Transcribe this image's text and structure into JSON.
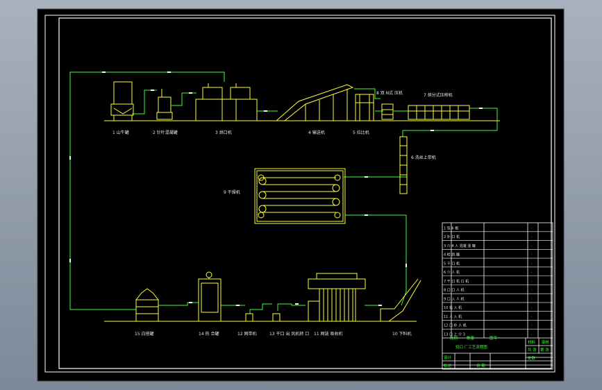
{
  "drawing": {
    "colors": {
      "frame": "#ffffff",
      "equipment": "#ffff33",
      "pipe": "#39ff39",
      "label": "#e8e8e8",
      "title": "#39ff39"
    },
    "labels": {
      "l1": "1 山牛罐",
      "l2": "2 针叶混凝罐",
      "l3": "3 烘口机",
      "l4": "4 输送机",
      "l5": "5 拉比机",
      "l6": "6 洗丝上带机",
      "l7": "7 烘分式压榨机",
      "l8": "8 双 N式 压机",
      "l9": "9 干燥机",
      "l10": "10 下料机",
      "l11": "11 网链 吸收机",
      "l12": "12 网带机",
      "l13": "13 干口 出 风机转 口",
      "l14": "14 热 合罐",
      "l15": "15 白搭罐"
    },
    "title_block": {
      "title": "饲口 厂工艺流程图",
      "rows": [
        "1 包 6 根",
        "2 扑 口 机",
        "3 介 4 人 混凝 混 罐",
        "4 检 具 器",
        "5 干 口 机",
        "6 介 人 机",
        "7 干 口 机 口 机",
        "8 口 口 人 机",
        "9 口 入 人 机",
        "10 机 入 机",
        "11 人 入 机",
        "12 口 扑 人 机",
        "13 口 上 介 3"
      ],
      "cells": {
        "c1": "比例",
        "c2": "数量",
        "c3": "共 张",
        "c4": "第 张",
        "c5": "材料",
        "c6": "图号",
        "c7": "设计",
        "c8": "审核",
        "c9": "日 期",
        "c10": "标记",
        "c11": "处数"
      }
    }
  }
}
